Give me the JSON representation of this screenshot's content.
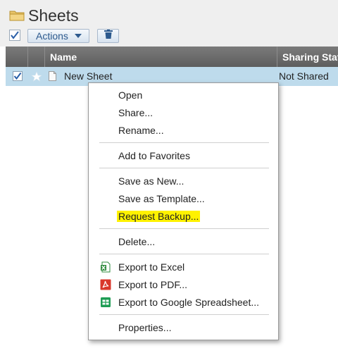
{
  "header": {
    "title": "Sheets",
    "actions_label": "Actions"
  },
  "table": {
    "columns": {
      "name": "Name",
      "sharing_status": "Sharing Status"
    },
    "rows": [
      {
        "name": "New Sheet",
        "sharing": "Not Shared",
        "checked": true,
        "favorite": false
      }
    ]
  },
  "context_menu": {
    "items": [
      {
        "label": "Open"
      },
      {
        "label": "Share..."
      },
      {
        "label": "Rename..."
      },
      {
        "label": "Add to Favorites"
      },
      {
        "label": "Save as New..."
      },
      {
        "label": "Save as Template..."
      },
      {
        "label": "Request Backup...",
        "highlighted": true
      },
      {
        "label": "Delete..."
      },
      {
        "label": "Export to Excel",
        "icon": "excel-icon"
      },
      {
        "label": "Export to PDF...",
        "icon": "pdf-icon"
      },
      {
        "label": "Export to Google Spreadsheet...",
        "icon": "google-sheets-icon"
      },
      {
        "label": "Properties..."
      }
    ]
  },
  "colors": {
    "selected_row": "#bedbec",
    "highlight": "#fff200",
    "button_text": "#2d5a8e"
  }
}
